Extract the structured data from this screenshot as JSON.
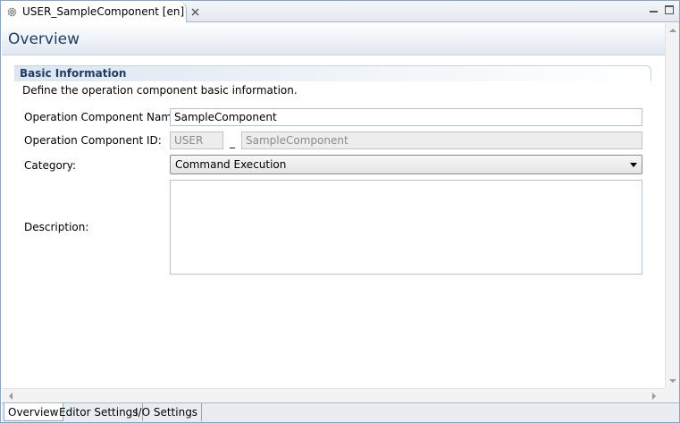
{
  "editor_tab": {
    "title": "USER_SampleComponent [en]"
  },
  "header": {
    "title": "Overview"
  },
  "section": {
    "title": "Basic Information",
    "description": "Define the operation component basic information."
  },
  "form": {
    "name_label": "Operation Component Name:",
    "name_value": "SampleComponent",
    "id_label": "Operation Component ID:",
    "id_prefix": "USER",
    "id_separator": "_",
    "id_value": "SampleComponent",
    "category_label": "Category:",
    "category_value": "Command Execution",
    "description_label": "Description:",
    "description_value": ""
  },
  "page_tabs": [
    {
      "label": "Overview",
      "active": true
    },
    {
      "label": "Editor Settings",
      "active": false
    },
    {
      "label": "I/O Settings",
      "active": false
    }
  ],
  "icons": {
    "tab": "gear-icon",
    "close": "close-icon",
    "minimize": "minimize-icon",
    "maximize": "maximize-icon",
    "dropdown": "chevron-down-icon"
  }
}
